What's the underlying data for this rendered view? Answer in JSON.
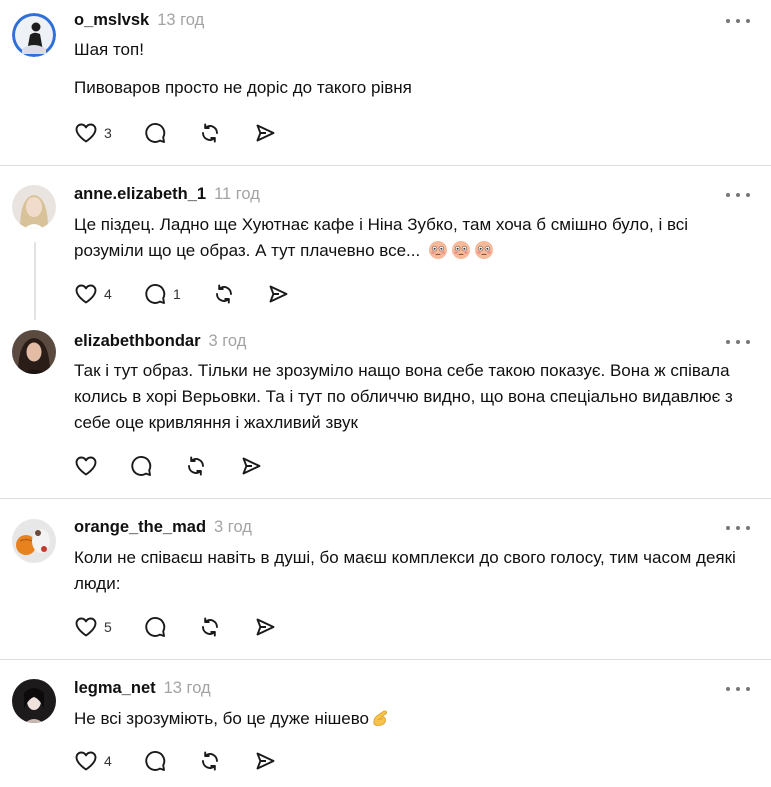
{
  "posts": [
    {
      "username": "o_mslvsk",
      "time": "13 год",
      "lines": [
        "Шая топ!",
        "Пивоваров просто не доріс до такого рівня"
      ],
      "likes": "3",
      "replies": ""
    },
    {
      "username": "anne.elizabeth_1",
      "time": "11 год",
      "lines": [
        "Це піздец. Ладно ще Хуютнає кафе і Ніна Зубко, там хоча б смішно було, і всі розуміли що це образ. А тут плачевно все..."
      ],
      "emoji": [
        "flushed-face",
        "flushed-face",
        "flushed-face"
      ],
      "likes": "4",
      "replies": "1"
    },
    {
      "username": "elizabethbondar",
      "time": "3 год",
      "lines": [
        "Так і тут образ. Тільки не зрозуміло нащо вона себе такою показує. Вона ж співала колись в хорі Верьовки. Та і тут по обличчю видно, що вона спеціально видавлює з себе оце кривляння і жахливий звук"
      ],
      "likes": "",
      "replies": ""
    },
    {
      "username": "orange_the_mad",
      "time": "3 год",
      "lines": [
        "Коли не співаєш навіть в душі, бо маєш комплекси до свого голосу, тим часом деякі люди:"
      ],
      "likes": "5",
      "replies": ""
    },
    {
      "username": "legma_net",
      "time": "13 год",
      "lines": [
        "Не всі зрозуміють, бо це дуже нішево"
      ],
      "emoji": [
        "pinching-hand"
      ],
      "likes": "4",
      "replies": ""
    }
  ],
  "icons": {
    "like": "heart-icon",
    "reply": "comment-icon",
    "repost": "repost-icon",
    "share": "send-icon",
    "more": "more-dots-icon"
  },
  "colors": {
    "text": "#101010",
    "muted": "#a3a3a3",
    "icon": "#1a1a1a",
    "divider": "#dedede"
  }
}
